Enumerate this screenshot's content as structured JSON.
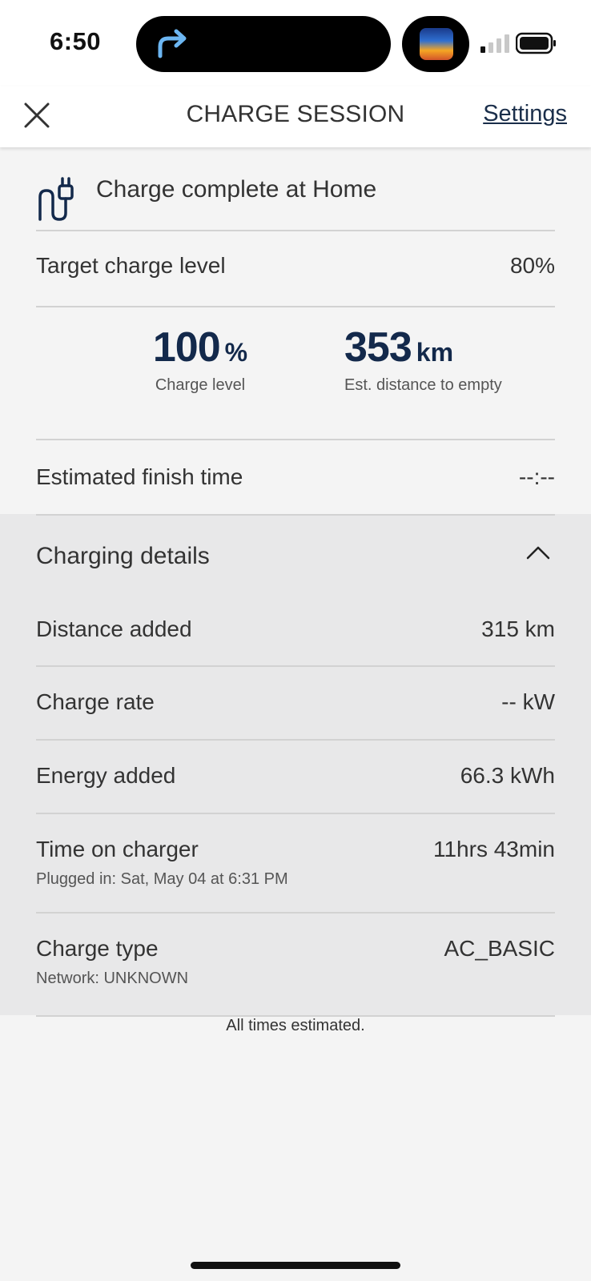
{
  "status_bar": {
    "time": "6:50",
    "icons": [
      "forward-arrow-icon",
      "album-art-thumbnail",
      "cellular-signal-icon",
      "battery-icon"
    ]
  },
  "header": {
    "title": "CHARGE SESSION",
    "settings_label": "Settings",
    "close_icon": "close-icon"
  },
  "status": {
    "icon": "plug-icon",
    "text": "Charge complete at Home"
  },
  "target": {
    "label": "Target charge level",
    "value": "80%"
  },
  "stats": {
    "charge_level": {
      "value": "100",
      "unit": "%",
      "caption": "Charge level"
    },
    "distance": {
      "value": "353",
      "unit": "km",
      "caption": "Est. distance to empty"
    }
  },
  "finish_time": {
    "label": "Estimated finish time",
    "value": "--:--"
  },
  "details": {
    "title": "Charging details",
    "toggle_icon": "chevron-up-icon",
    "rows": [
      {
        "label": "Distance added",
        "value": "315 km"
      },
      {
        "label": "Charge rate",
        "value": "-- kW"
      },
      {
        "label": "Energy added",
        "value": "66.3 kWh"
      },
      {
        "label": "Time on charger",
        "value": "11hrs 43min",
        "sublabel": "Plugged in: Sat, May 04 at 6:31 PM"
      },
      {
        "label": "Charge type",
        "value": "AC_BASIC",
        "sublabel": "Network: UNKNOWN"
      }
    ]
  },
  "footer_note": "All times estimated.",
  "colors": {
    "accent_navy": "#13294b",
    "link": "#1a2e4a",
    "background": "#f4f4f4",
    "panel": "#e8e8e9"
  }
}
